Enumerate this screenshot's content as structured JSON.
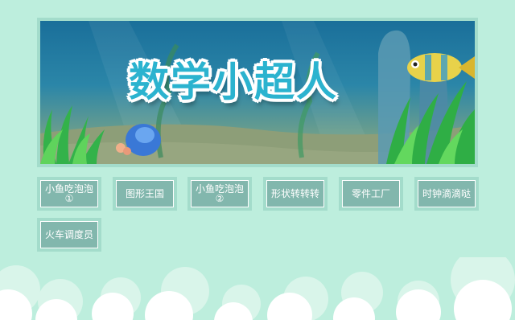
{
  "banner": {
    "title": "数学小超人"
  },
  "games": [
    {
      "label": "小鱼吃泡泡",
      "sub": "①"
    },
    {
      "label": "图形王国",
      "sub": ""
    },
    {
      "label": "小鱼吃泡泡",
      "sub": "②"
    },
    {
      "label": "形状转转转",
      "sub": ""
    },
    {
      "label": "零件工厂",
      "sub": ""
    },
    {
      "label": "时钟滴滴哒",
      "sub": ""
    },
    {
      "label": "火车调度员",
      "sub": ""
    }
  ],
  "colors": {
    "background": "#bdeedd",
    "frame": "#a3dccb",
    "button_fill": "#82b7ad",
    "title_text": "#2bb3cf"
  }
}
